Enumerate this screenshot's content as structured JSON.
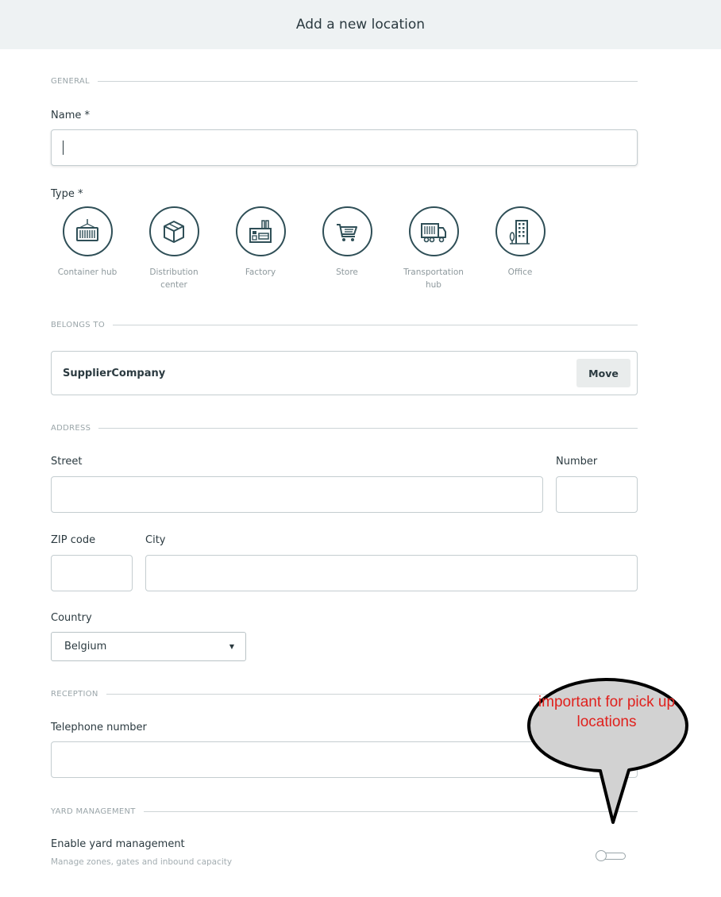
{
  "header": {
    "title": "Add a new location"
  },
  "sections": {
    "general": "GENERAL",
    "belongs_to": "BELONGS TO",
    "address": "ADDRESS",
    "reception": "RECEPTION",
    "yard": "YARD MANAGEMENT"
  },
  "name_field": {
    "label": "Name *",
    "value": ""
  },
  "type_field": {
    "label": "Type *",
    "options": [
      {
        "label": "Container hub",
        "icon": "container-icon"
      },
      {
        "label": "Distribution center",
        "icon": "box-icon"
      },
      {
        "label": "Factory",
        "icon": "factory-icon"
      },
      {
        "label": "Store",
        "icon": "cart-icon"
      },
      {
        "label": "Transportation hub",
        "icon": "truck-icon"
      },
      {
        "label": "Office",
        "icon": "office-building-icon"
      }
    ]
  },
  "belongs_to": {
    "company": "SupplierCompany",
    "move_label": "Move"
  },
  "address": {
    "street_label": "Street",
    "number_label": "Number",
    "zip_label": "ZIP code",
    "city_label": "City",
    "country_label": "Country",
    "country_value": "Belgium"
  },
  "reception": {
    "phone_label": "Telephone number"
  },
  "yard": {
    "enable_label": "Enable yard management",
    "description": "Manage zones, gates and inbound capacity",
    "enabled": false
  },
  "callout": {
    "text": "important for pick up locations",
    "color": "#e0211d"
  },
  "colors": {
    "accent": "#2f4f57",
    "header_bg": "#eef2f3"
  }
}
